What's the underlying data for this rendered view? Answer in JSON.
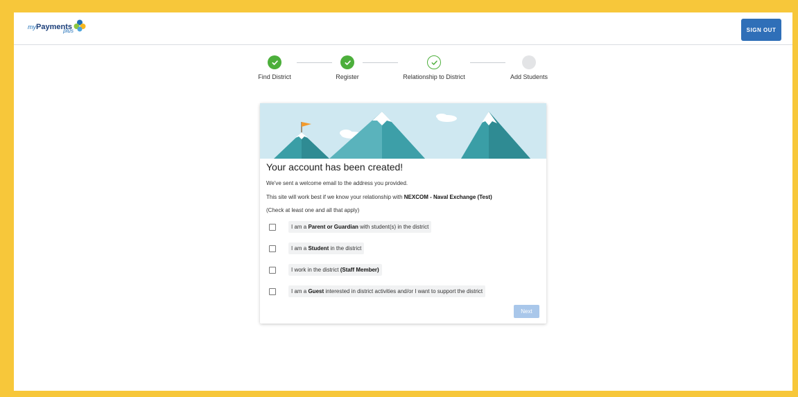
{
  "header": {
    "logo": {
      "my": "my",
      "payments": "Payments",
      "plus": "plus"
    },
    "signout_label": "SIGN OUT"
  },
  "stepper": {
    "steps": [
      {
        "label": "Find District",
        "state": "done"
      },
      {
        "label": "Register",
        "state": "done"
      },
      {
        "label": "Relationship to District",
        "state": "current"
      },
      {
        "label": "Add Students",
        "state": "todo"
      }
    ]
  },
  "card": {
    "title": "Your account has been created!",
    "welcome_text": "We've sent a welcome email to the address you provided.",
    "relationship_prefix": "This site will work best if we know your relationship with ",
    "district_name": "NEXCOM - Naval Exchange (Test)",
    "instruction": "(Check at least one and all that apply)",
    "options": [
      {
        "prefix": "I am a ",
        "bold": "Parent or Guardian",
        "suffix": " with student(s) in the district",
        "checked": false
      },
      {
        "prefix": "I am a ",
        "bold": "Student",
        "suffix": " in the district",
        "checked": false
      },
      {
        "prefix": "I work in the district ",
        "bold": "(Staff Member)",
        "suffix": "",
        "checked": false
      },
      {
        "prefix": "I am a ",
        "bold": "Guest",
        "suffix": " interested in district activities and/or I want to support the district",
        "checked": false
      }
    ],
    "next_label": "Next"
  },
  "colors": {
    "accent": "#2f6fb8",
    "success": "#4caf3b",
    "border_frame": "#f7c73a",
    "next_disabled": "#a9c7ea"
  }
}
